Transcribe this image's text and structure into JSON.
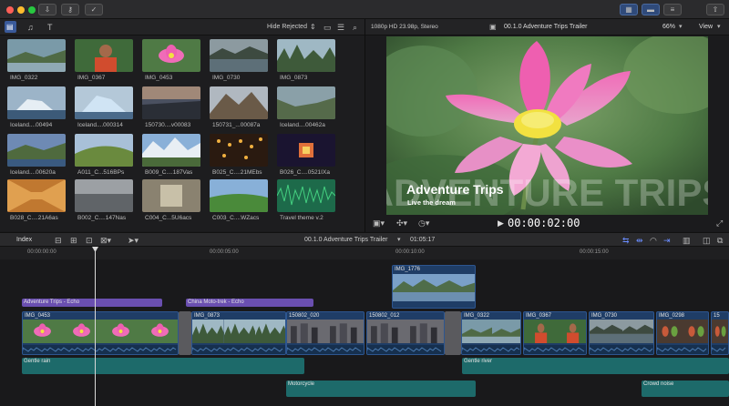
{
  "titlebar": {
    "icons": [
      "download-icon",
      "key-icon",
      "checkmark-icon"
    ]
  },
  "browser": {
    "filter": "Hide Rejected",
    "clips": [
      {
        "name": "IMG_0322",
        "theme": "river"
      },
      {
        "name": "IMG_0367",
        "theme": "person"
      },
      {
        "name": "IMG_0453",
        "theme": "lotus"
      },
      {
        "name": "IMG_0730",
        "theme": "lake"
      },
      {
        "name": "IMG_0873",
        "theme": "karst"
      },
      {
        "name": "Iceland....00494",
        "theme": "iceberg"
      },
      {
        "name": "Iceland....000314",
        "theme": "ice"
      },
      {
        "name": "150730....v00083",
        "theme": "dusk"
      },
      {
        "name": "150731_...00087a",
        "theme": "mountain"
      },
      {
        "name": "Iceland....00462a",
        "theme": "valley"
      },
      {
        "name": "Iceland....00620a",
        "theme": "coast"
      },
      {
        "name": "A011_C...516BPs",
        "theme": "hill"
      },
      {
        "name": "B009_C....187Vas",
        "theme": "alps"
      },
      {
        "name": "B025_C....21MEbs",
        "theme": "lights"
      },
      {
        "name": "B026_C....0521IXa",
        "theme": "tunnel"
      },
      {
        "name": "B028_C....21A6as",
        "theme": "corridor"
      },
      {
        "name": "B002_C....147Nas",
        "theme": "plaza"
      },
      {
        "name": "C004_C...5U6acs",
        "theme": "aerial"
      },
      {
        "name": "C003_C....WZacs",
        "theme": "field"
      },
      {
        "name": "Travel theme v.2",
        "theme": "audio"
      }
    ]
  },
  "viewer": {
    "format": "1080p HD 23.98p, Stereo",
    "project": "00.1.0 Adventure Trips Trailer",
    "zoom": "66%",
    "view_menu": "View",
    "title_text": "Adventure Trips",
    "subtitle_text": "Live the dream",
    "watermark_text": "ADVENTURE TRIPS",
    "timecode": "00:00:02:00"
  },
  "timeline": {
    "index_label": "Index",
    "project": "00.1.0 Adventure Trips Trailer",
    "duration": "01:05:17",
    "ruler": [
      "00:00:00:00",
      "00:00:05:00",
      "00:00:10:00",
      "00:00:15:00"
    ],
    "connected_clip": "IMG_1776",
    "titles": [
      {
        "name": "Adventure Trips - Echo"
      },
      {
        "name": "China Moto-trek - Echo"
      }
    ],
    "storyline": [
      {
        "name": "IMG_0453",
        "theme": "lotus"
      },
      {
        "name": "IMG_0873",
        "theme": "karst"
      },
      {
        "name": "150802_020",
        "theme": "city"
      },
      {
        "name": "150802_012",
        "theme": "city"
      },
      {
        "name": "IMG_0322",
        "theme": "river"
      },
      {
        "name": "IMG_0367",
        "theme": "person"
      },
      {
        "name": "IMG_0730",
        "theme": "lake"
      },
      {
        "name": "IMG_0298",
        "theme": "food"
      },
      {
        "name": "15",
        "theme": "food"
      }
    ],
    "audio": [
      {
        "name": "Gentle rain"
      },
      {
        "name": "Gentle river"
      },
      {
        "name": "Motorcycle"
      },
      {
        "name": "Crowd noise"
      }
    ]
  }
}
